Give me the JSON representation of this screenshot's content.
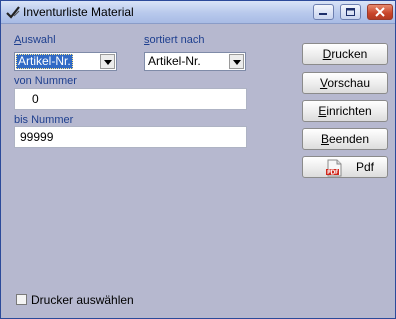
{
  "window": {
    "title": "Inventurliste Material",
    "icon": "checkmark-edit-icon"
  },
  "titlebar_buttons": {
    "minimize": "minimize-icon",
    "maximize": "maximize-icon",
    "close": "close-icon"
  },
  "auswahl": {
    "label_first": "A",
    "label_rest": "uswahl",
    "value": "Artikel-Nr."
  },
  "sortiert": {
    "label_first": "s",
    "label_rest": "ortiert nach",
    "value": "Artikel-Nr."
  },
  "von_nummer": {
    "label": "von Nummer",
    "value": "0"
  },
  "bis_nummer": {
    "label": "bis Nummer",
    "value": "99999"
  },
  "buttons": {
    "drucken": {
      "first": "D",
      "rest": "rucken"
    },
    "vorschau": {
      "first": "V",
      "rest": "orschau"
    },
    "einrichten": {
      "first": "E",
      "rest": "inrichten"
    },
    "beenden": {
      "first": "B",
      "rest": "eenden"
    },
    "pdf": {
      "label": "Pdf",
      "icon": "pdf-file-icon"
    }
  },
  "drucker_auswaehlen": {
    "label": "Drucker auswählen",
    "checked": false
  },
  "colors": {
    "window_bg": "#b6b8cf",
    "label_blue": "#1e3f8f",
    "selection": "#316ac5",
    "close_red": "#c8452a"
  }
}
